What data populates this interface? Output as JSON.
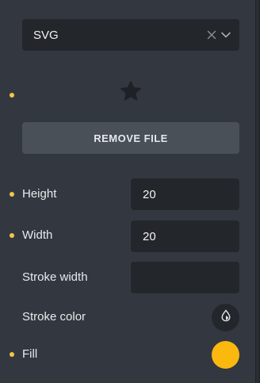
{
  "file_select": {
    "value": "SVG",
    "clear_icon": "close-icon",
    "chevron_icon": "chevron-down-icon"
  },
  "preview": {
    "icon": "star-icon"
  },
  "remove_button": {
    "label": "REMOVE FILE"
  },
  "fields": {
    "height": {
      "label": "Height",
      "value": "20"
    },
    "width": {
      "label": "Width",
      "value": "20"
    },
    "stroke_width": {
      "label": "Stroke width",
      "value": ""
    },
    "stroke_color": {
      "label": "Stroke color",
      "icon": "color-drop-icon"
    },
    "fill": {
      "label": "Fill",
      "color": "#fbb80f"
    }
  },
  "colors": {
    "panel_bg": "#333840",
    "input_bg": "#23272c",
    "button_bg": "#4a5058",
    "indicator_dot": "#f0c649",
    "fill_swatch": "#fbb80f"
  }
}
